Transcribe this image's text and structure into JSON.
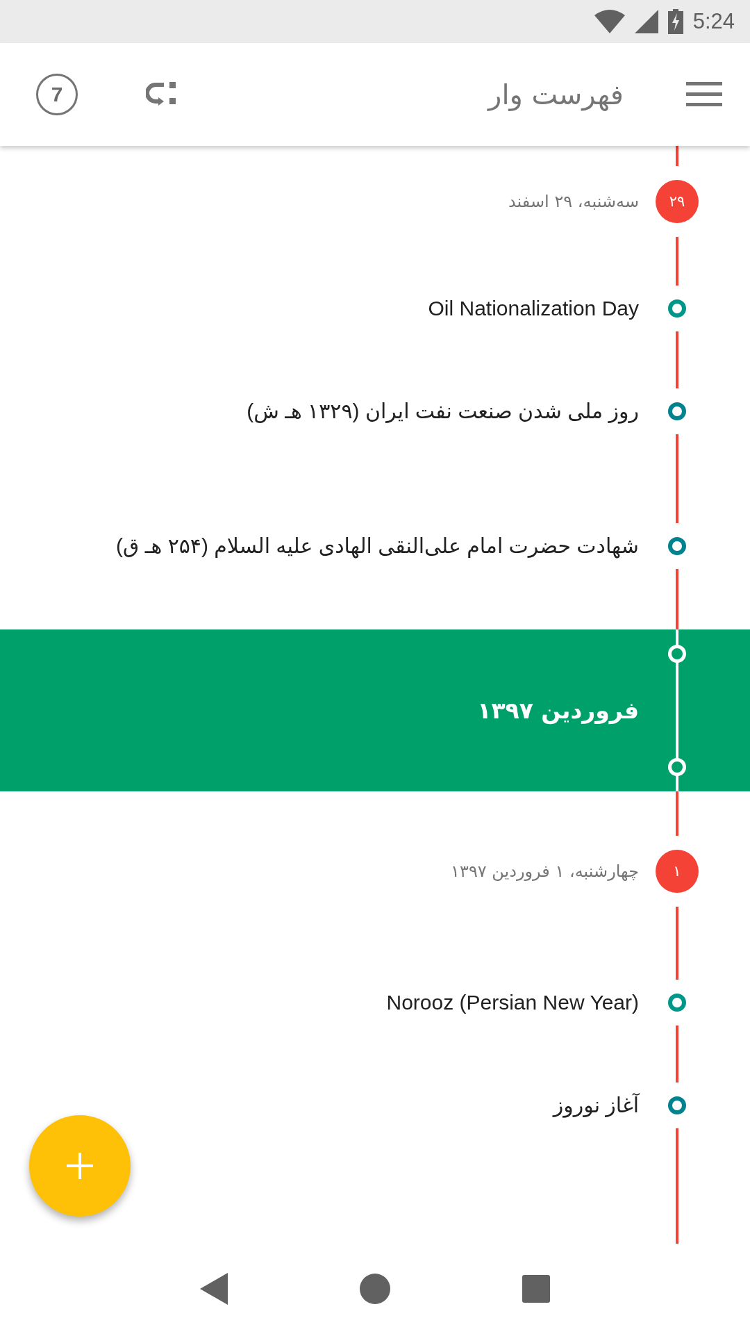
{
  "status_bar": {
    "time": "5:24"
  },
  "app_bar": {
    "title": "فهرست وار",
    "badge_count": "7"
  },
  "timeline": [
    {
      "kind": "date",
      "day": "۲۹",
      "label": "سه‌شنبه، ۲۹ اسفند"
    },
    {
      "kind": "event",
      "title": "Oil Nationalization Day",
      "color": "#009688"
    },
    {
      "kind": "event",
      "title": "روز ملی شدن صنعت نفت ایران (۱۳۲۹ هـ ش)",
      "color": "#00838f"
    },
    {
      "kind": "event",
      "title": "شهادت حضرت امام علی‌النقی الهادی علیه السلام (۲۵۴ هـ ق)",
      "color": "#00838f"
    },
    {
      "kind": "month",
      "label": "فروردین ۱۳۹۷"
    },
    {
      "kind": "date",
      "day": "۱",
      "label": "چهارشنبه، ۱ فروردین ۱۳۹۷"
    },
    {
      "kind": "event",
      "title": "Norooz (Persian New Year)",
      "color": "#009688"
    },
    {
      "kind": "event",
      "title": "آغاز نوروز",
      "color": "#00838f"
    }
  ]
}
